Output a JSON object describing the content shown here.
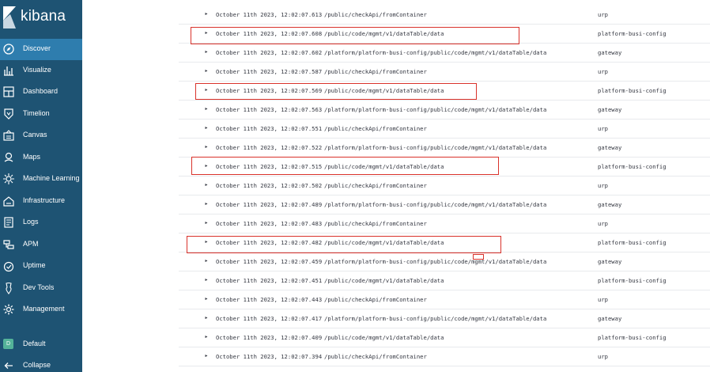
{
  "app": {
    "name": "kibana"
  },
  "sidebar": {
    "items": [
      {
        "label": "Discover",
        "icon": "compass-icon",
        "active": true
      },
      {
        "label": "Visualize",
        "icon": "bar-chart-icon"
      },
      {
        "label": "Dashboard",
        "icon": "dashboard-icon"
      },
      {
        "label": "Timelion",
        "icon": "shield-icon"
      },
      {
        "label": "Canvas",
        "icon": "canvas-icon"
      },
      {
        "label": "Maps",
        "icon": "maps-icon"
      },
      {
        "label": "Machine Learning",
        "icon": "machine-learning-icon"
      },
      {
        "label": "Infrastructure",
        "icon": "infrastructure-icon"
      },
      {
        "label": "Logs",
        "icon": "logs-icon"
      },
      {
        "label": "APM",
        "icon": "apm-icon"
      },
      {
        "label": "Uptime",
        "icon": "uptime-icon"
      },
      {
        "label": "Dev Tools",
        "icon": "wrench-icon"
      },
      {
        "label": "Management",
        "icon": "gear-icon"
      }
    ],
    "space": {
      "label": "Default",
      "badge": "D"
    },
    "collapse": {
      "label": "Collapse",
      "icon": "arrow-left-icon"
    }
  },
  "rows": [
    {
      "time": "October 11th 2023, 12:02:07.613",
      "uri": "/public/checkApi/fromContainer",
      "app": "urp"
    },
    {
      "time": "October 11th 2023, 12:02:07.608",
      "uri": "/public/code/mgmt/v1/dataTable/data",
      "app": "platform-busi-config"
    },
    {
      "time": "October 11th 2023, 12:02:07.602",
      "uri": "/platform/platform-busi-config/public/code/mgmt/v1/dataTable/data",
      "app": "gateway"
    },
    {
      "time": "October 11th 2023, 12:02:07.587",
      "uri": "/public/checkApi/fromContainer",
      "app": "urp"
    },
    {
      "time": "October 11th 2023, 12:02:07.569",
      "uri": "/public/code/mgmt/v1/dataTable/data",
      "app": "platform-busi-config"
    },
    {
      "time": "October 11th 2023, 12:02:07.563",
      "uri": "/platform/platform-busi-config/public/code/mgmt/v1/dataTable/data",
      "app": "gateway"
    },
    {
      "time": "October 11th 2023, 12:02:07.551",
      "uri": "/public/checkApi/fromContainer",
      "app": "urp"
    },
    {
      "time": "October 11th 2023, 12:02:07.522",
      "uri": "/platform/platform-busi-config/public/code/mgmt/v1/dataTable/data",
      "app": "gateway"
    },
    {
      "time": "October 11th 2023, 12:02:07.515",
      "uri": "/public/code/mgmt/v1/dataTable/data",
      "app": "platform-busi-config"
    },
    {
      "time": "October 11th 2023, 12:02:07.502",
      "uri": "/public/checkApi/fromContainer",
      "app": "urp"
    },
    {
      "time": "October 11th 2023, 12:02:07.489",
      "uri": "/platform/platform-busi-config/public/code/mgmt/v1/dataTable/data",
      "app": "gateway"
    },
    {
      "time": "October 11th 2023, 12:02:07.483",
      "uri": "/public/checkApi/fromContainer",
      "app": "urp"
    },
    {
      "time": "October 11th 2023, 12:02:07.482",
      "uri": "/public/code/mgmt/v1/dataTable/data",
      "app": "platform-busi-config"
    },
    {
      "time": "October 11th 2023, 12:02:07.459",
      "uri": "/platform/platform-busi-config/public/code/mgmt/v1/dataTable/data",
      "app": "gateway"
    },
    {
      "time": "October 11th 2023, 12:02:07.451",
      "uri": "/public/code/mgmt/v1/dataTable/data",
      "app": "platform-busi-config"
    },
    {
      "time": "October 11th 2023, 12:02:07.443",
      "uri": "/public/checkApi/fromContainer",
      "app": "urp"
    },
    {
      "time": "October 11th 2023, 12:02:07.417",
      "uri": "/platform/platform-busi-config/public/code/mgmt/v1/dataTable/data",
      "app": "gateway"
    },
    {
      "time": "October 11th 2023, 12:02:07.409",
      "uri": "/public/code/mgmt/v1/dataTable/data",
      "app": "platform-busi-config"
    },
    {
      "time": "October 11th 2023, 12:02:07.394",
      "uri": "/public/checkApi/fromContainer",
      "app": "urp"
    }
  ],
  "row_toggle_glyph": "▸",
  "highlight_color": "#d9322b",
  "colors": {
    "sidebar": "#1e5373",
    "sidebar_active": "#2e7dae",
    "text": "#343741"
  }
}
